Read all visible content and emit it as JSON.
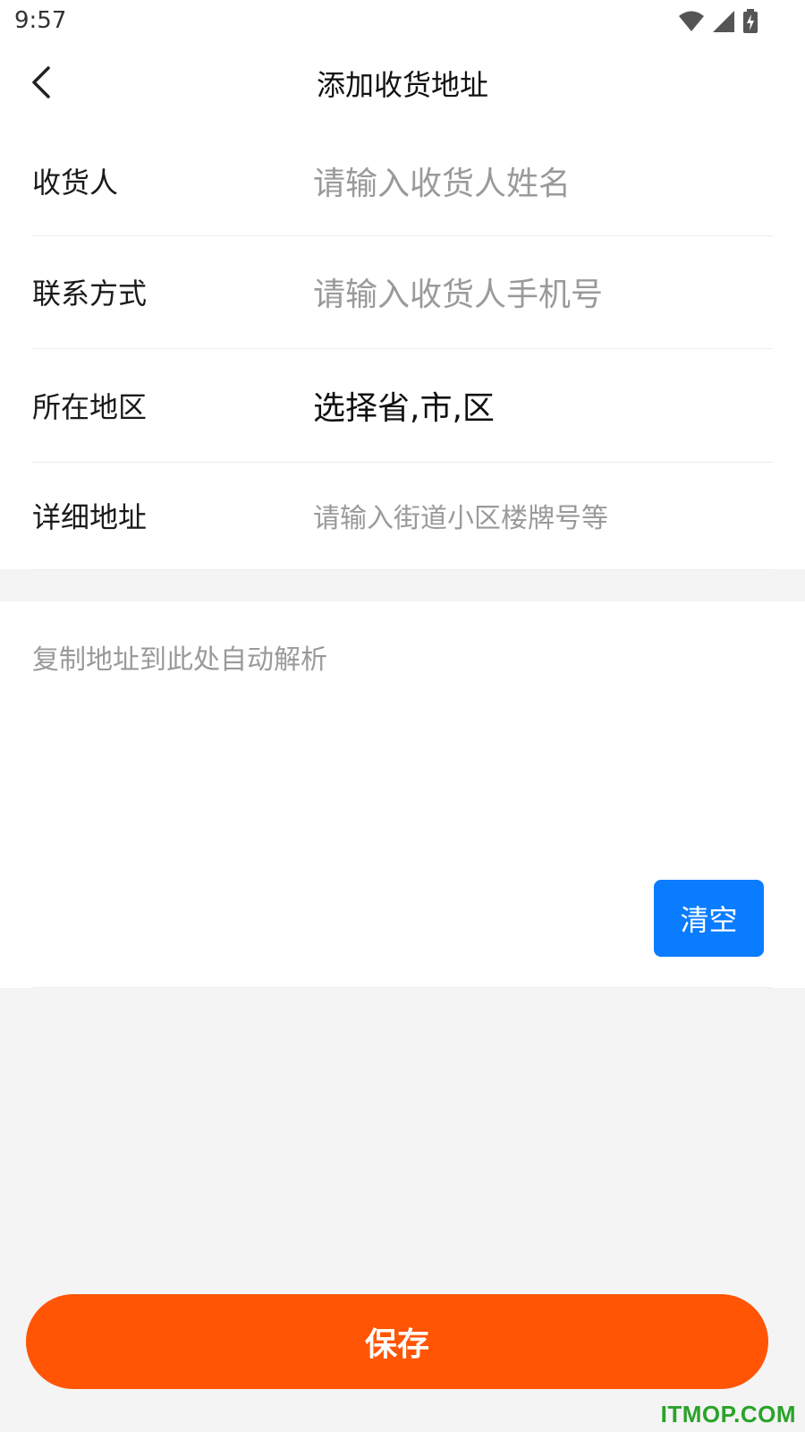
{
  "status_bar": {
    "time": "9:57",
    "icons": [
      "wifi-icon",
      "signal-icon",
      "battery-charging-icon"
    ]
  },
  "header": {
    "back_icon": "chevron-left-icon",
    "title": "添加收货地址"
  },
  "form": {
    "rows": [
      {
        "label": "收货人",
        "placeholder": "请输入收货人姓名"
      },
      {
        "label": "联系方式",
        "placeholder": "请输入收货人手机号"
      },
      {
        "label": "所在地区",
        "value": "选择省,市,区"
      },
      {
        "label": "详细地址",
        "placeholder": "请输入街道小区楼牌号等"
      }
    ]
  },
  "parse": {
    "placeholder": "复制地址到此处自动解析",
    "clear_label": "清空",
    "clear_color": "#0a7cff"
  },
  "footer": {
    "save_label": "保存",
    "save_color": "#ff5505"
  },
  "watermark": "ITMOP.COM"
}
